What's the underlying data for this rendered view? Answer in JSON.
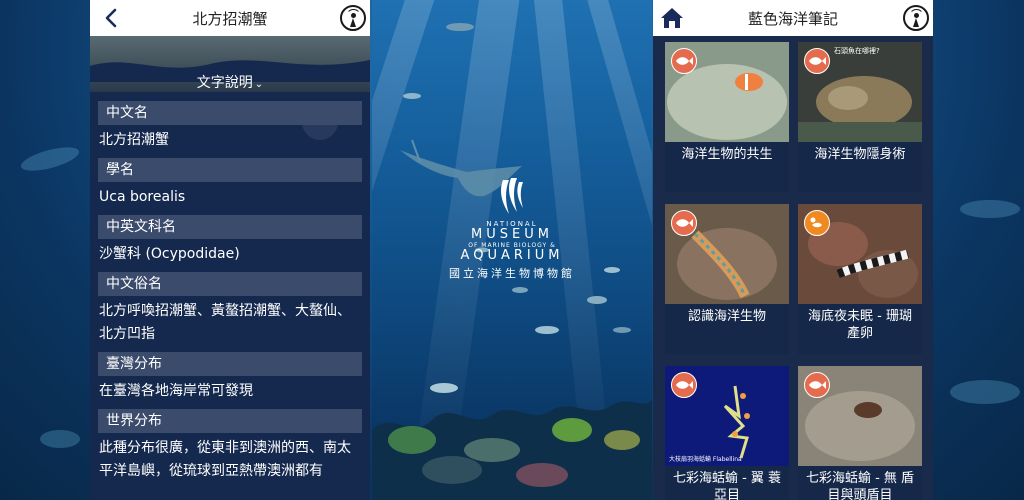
{
  "left_screen": {
    "nav_title": "北方招潮蟹",
    "section_toggle": "文字說明",
    "fields": [
      {
        "label": "中文名",
        "value": "北方招潮蟹"
      },
      {
        "label": "學名",
        "value": "Uca borealis"
      },
      {
        "label": "中英文科名",
        "value": "沙蟹科 (Ocypodidae)"
      },
      {
        "label": "中文俗名",
        "value": "北方呼喚招潮蟹、黃螯招潮蟹、大螯仙、北方凹指"
      },
      {
        "label": "臺灣分布",
        "value": "在臺灣各地海岸常可發現"
      },
      {
        "label": "世界分布",
        "value": "此種分布很廣，從東非到澳洲的西、南太平洋島嶼，從琉球到亞熱帶澳洲都有"
      }
    ],
    "icons": {
      "back": "back-arrow-icon",
      "audio": "audio-guide-icon",
      "toggle": "chevron-down-icon"
    }
  },
  "splash": {
    "logo_line1": "NATIONAL",
    "logo_line2": "MUSEUM",
    "logo_line3": "OF MARINE BIOLOGY &",
    "logo_line4": "AQUARIUM",
    "logo_line5": "國立海洋生物博物館"
  },
  "right_screen": {
    "nav_title": "藍色海洋筆記",
    "icons": {
      "home": "home-icon",
      "audio": "audio-guide-icon"
    },
    "cards": [
      {
        "title": "海洋生物的共生",
        "badge": "fish-icon",
        "badge_color": "#e56b4f"
      },
      {
        "title": "海洋生物隱身術",
        "badge": "fish-icon",
        "badge_color": "#e56b4f",
        "thumb_caption": "石頭魚在哪裡?"
      },
      {
        "title": "認識海洋生物",
        "badge": "fish-icon",
        "badge_color": "#e56b4f"
      },
      {
        "title": "海底夜未眠 - 珊瑚產卵",
        "badge": "night-fish-icon",
        "badge_color": "#f08a20"
      },
      {
        "title": "七彩海蛞蝓 - 翼 蓑亞目",
        "badge": "fish-icon",
        "badge_color": "#e56b4f",
        "thumb_caption": "大枝扇羽海蛞蝓 Flabellina"
      },
      {
        "title": "七彩海蛞蝓 - 無 盾目與頭盾目",
        "badge": "fish-icon",
        "badge_color": "#e56b4f"
      }
    ]
  },
  "colors": {
    "label_bg": "#3b4b6c",
    "phone_bg": "#15294f",
    "badge_red": "#e56b4f",
    "badge_orange": "#f08a20"
  }
}
